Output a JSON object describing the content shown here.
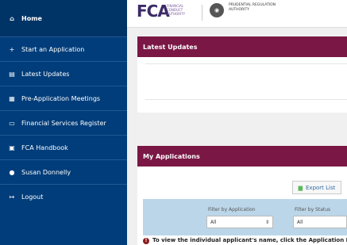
{
  "sidebar": {
    "items": [
      {
        "label": "Home",
        "icon": "home-icon",
        "glyph": "⌂"
      },
      {
        "label": "Start an Application",
        "icon": "plus-icon",
        "glyph": "+"
      },
      {
        "label": "Latest Updates",
        "icon": "card-icon",
        "glyph": "▤"
      },
      {
        "label": "Pre-Application Meetings",
        "icon": "calendar-icon",
        "glyph": "▦"
      },
      {
        "label": "Financial Services Register",
        "icon": "monitor-icon",
        "glyph": "▭"
      },
      {
        "label": "FCA Handbook",
        "icon": "book-icon",
        "glyph": "▣"
      },
      {
        "label": "Susan Donnelly",
        "icon": "user-icon",
        "glyph": "●"
      },
      {
        "label": "Logout",
        "icon": "logout-icon",
        "glyph": "↦"
      }
    ]
  },
  "header": {
    "fca_mark": "FCA",
    "fca_line1": "FINANCIAL",
    "fca_line2": "CONDUCT",
    "fca_line3": "AUTHORITY",
    "pra_line1": "PRUDENTIAL REGULATION",
    "pra_line2": "AUTHORITY"
  },
  "latest_updates": {
    "title": "Latest Updates"
  },
  "applications": {
    "title": "My Applications",
    "export_label": "Export List",
    "filter_application_label": "Filter by Application",
    "filter_application_value": "All",
    "filter_status_label": "Filter by Status",
    "filter_status_value": "All",
    "info_text": "To view the individual applicant's name, click the Application Fi"
  },
  "colors": {
    "sidebar": "#003d7a",
    "panel_header": "#7a1745",
    "filter_bg": "#bcd6e9"
  }
}
